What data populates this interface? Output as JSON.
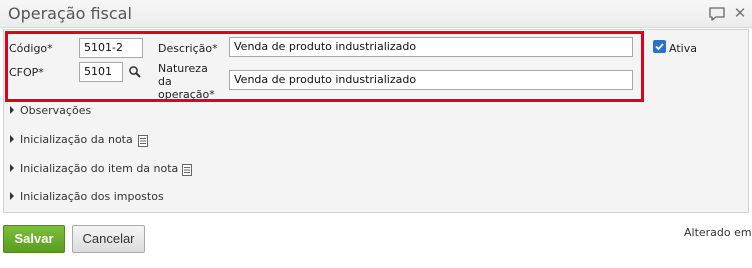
{
  "window": {
    "title": "Operação fiscal",
    "icons": [
      "chat-bubble-icon",
      "close-icon"
    ]
  },
  "form": {
    "codigo_label": "Código*",
    "codigo_value": "5101-2",
    "descricao_label": "Descrição*",
    "descricao_value": "Venda de produto industrializado",
    "ativa_label": "Ativa",
    "ativa_checked": true,
    "cfop_label": "CFOP*",
    "cfop_value": "5101",
    "natureza_label_line1": "Natureza",
    "natureza_label_line2": "da",
    "natureza_label_line3": "operação*",
    "natureza_value": "Venda de produto industrializado"
  },
  "sections": [
    {
      "label": "Observações"
    },
    {
      "label": "Inicialização da nota"
    },
    {
      "label": "Inicialização do item da nota"
    },
    {
      "label": "Inicialização dos impostos"
    }
  ],
  "footer": {
    "save_label": "Salvar",
    "cancel_label": "Cancelar",
    "altered_label": "Alterado em"
  },
  "colors": {
    "highlight": "#e0001a",
    "save_button": "#6aae2c",
    "checkbox": "#2a72c8"
  }
}
